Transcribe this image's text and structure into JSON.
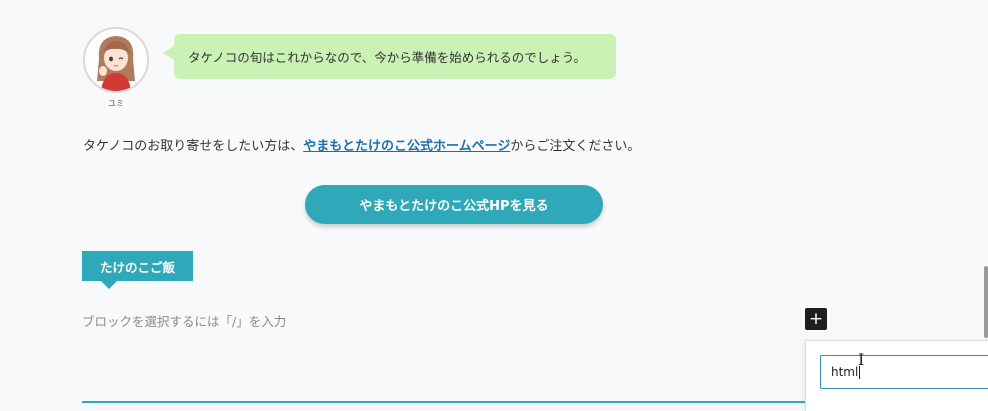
{
  "speaker": {
    "name": "ユミ",
    "message": "タケノコの旬はこれからなので、今から準備を始められるのでしょう。"
  },
  "intro": {
    "prefix": "タケノコのお取り寄せをしたい方は、",
    "link_text": "やまもとたけのこ公式ホームページ",
    "suffix": "からご注文ください。"
  },
  "cta_button": {
    "label": "やまもとたけのこ公式HPを見る"
  },
  "section_heading": {
    "label": "たけのこご飯"
  },
  "editor": {
    "block_placeholder": "ブロックを選択するには「/」を入力",
    "inserter_icon": "plus-icon",
    "search_value": "html"
  },
  "colors": {
    "accent": "#2fa9b9",
    "bubble": "#c9f2b4",
    "link": "#1a6fae"
  }
}
